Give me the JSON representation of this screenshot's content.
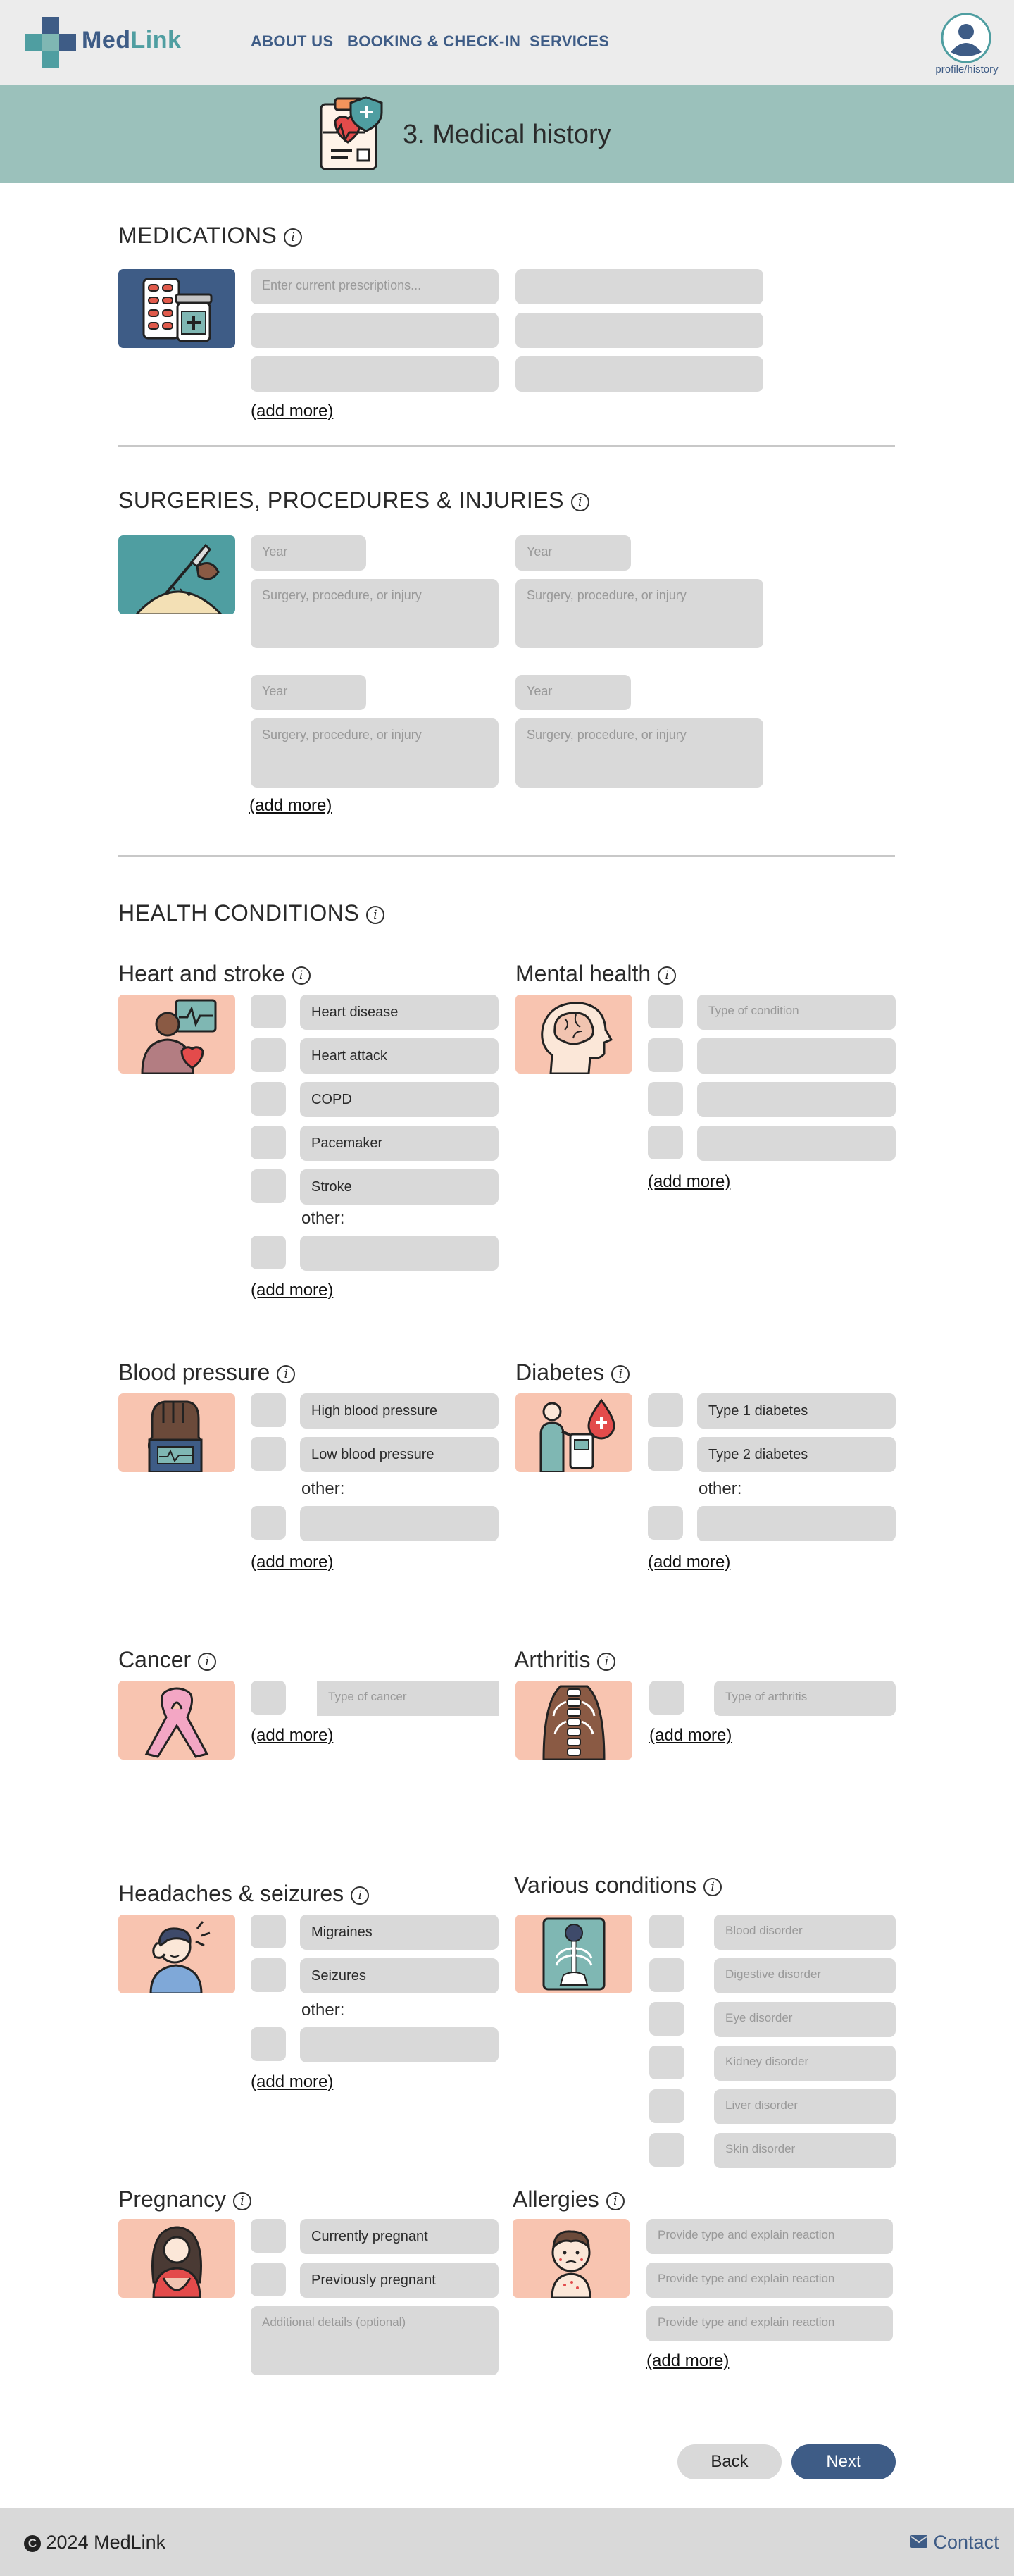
{
  "header": {
    "brand": "MedLink",
    "nav": [
      "ABOUT US",
      "BOOKING & CHECK-IN",
      "SERVICES"
    ],
    "profile_label": "profile/history"
  },
  "banner": {
    "title": "3. Medical history"
  },
  "info_glyph": "i",
  "medications": {
    "title": "MEDICATIONS",
    "placeholder": "Enter current prescriptions...",
    "add_more": "(add more)",
    "icon": "pill-bottle-icon"
  },
  "surgeries": {
    "title": "SURGERIES, PROCEDURES & INJURIES",
    "year_placeholder": "Year",
    "desc_placeholder": "Surgery, procedure, or injury",
    "add_more": "(add more)",
    "icon": "scalpel-icon"
  },
  "health": {
    "title": "HEALTH CONDITIONS",
    "heart": {
      "title": "Heart and stroke",
      "items": [
        "Heart disease",
        "Heart attack",
        "COPD",
        "Pacemaker",
        "Stroke"
      ],
      "other": "other:",
      "add_more": "(add more)"
    },
    "mental": {
      "title": "Mental health",
      "placeholder": "Type of condition",
      "add_more": "(add more)"
    },
    "blood": {
      "title": "Blood pressure",
      "items": [
        "High blood pressure",
        "Low blood pressure"
      ],
      "other": "other:",
      "add_more": "(add more)"
    },
    "diabetes": {
      "title": "Diabetes",
      "items": [
        "Type 1 diabetes",
        "Type 2 diabetes"
      ],
      "other": "other:",
      "add_more": "(add more)"
    },
    "cancer": {
      "title": "Cancer",
      "placeholder": "Type of cancer",
      "add_more": "(add more)"
    },
    "arthritis": {
      "title": "Arthritis",
      "placeholder": "Type of arthritis",
      "add_more": "(add more)"
    },
    "headaches": {
      "title": "Headaches & seizures",
      "items": [
        "Migraines",
        "Seizures"
      ],
      "other": "other:",
      "add_more": "(add more)"
    },
    "various": {
      "title": "Various conditions",
      "items": [
        "Blood disorder",
        "Digestive disorder",
        "Eye disorder",
        "Kidney disorder",
        "Liver disorder",
        "Skin disorder"
      ]
    },
    "pregnancy": {
      "title": "Pregnancy",
      "items": [
        "Currently pregnant",
        "Previously pregnant"
      ],
      "details_placeholder": "Additional details (optional)"
    },
    "allergies": {
      "title": "Allergies",
      "placeholder": "Provide type and explain reaction",
      "add_more": "(add more)"
    }
  },
  "actions": {
    "back": "Back",
    "next": "Next"
  },
  "footer": {
    "copyright": "2024 MedLink",
    "contact": "Contact"
  },
  "colors": {
    "header_bg": "#ececec",
    "banner_bg": "#9bc1bb",
    "nav_text": "#3e5c86",
    "next_button": "#3e5c86",
    "field_bg": "#d9d9d9",
    "icon_peach": "#f8c4b0",
    "icon_blue": "#3e5c86",
    "icon_teal": "#4f9ea1"
  }
}
